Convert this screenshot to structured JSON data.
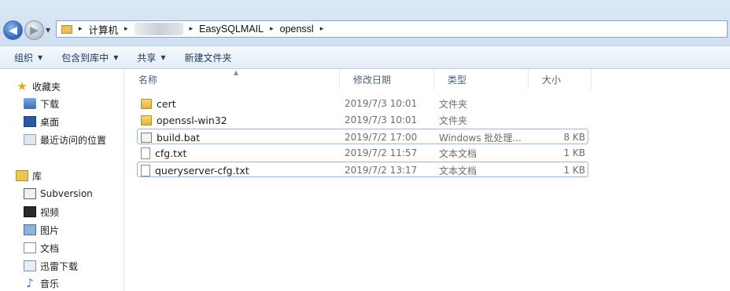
{
  "address_bar": {
    "back_label": "◀",
    "forward_label": "▶",
    "history_dropdown": "▼",
    "crumbs": [
      "计算机",
      "EasySQLMAIL",
      "openssl"
    ],
    "separator": "▸"
  },
  "toolbar": {
    "items": [
      "组织",
      "包含到库中",
      "共享",
      "新建文件夹"
    ],
    "dropdown_arrow": "▼"
  },
  "sidebar": {
    "favorites_title": "收藏夹",
    "favorites": [
      "下载",
      "桌面",
      "最近访问的位置"
    ],
    "library_title": "库",
    "libraries": [
      "Subversion",
      "视频",
      "图片",
      "文档",
      "迅雷下载",
      "音乐"
    ]
  },
  "file_list": {
    "columns": [
      "名称",
      "修改日期",
      "类型",
      "大小"
    ],
    "sort_indicator": "▲",
    "rows": [
      {
        "name": "cert",
        "date": "2019/7/3 10:01",
        "type": "文件夹",
        "size": "",
        "icon": "folder-icon"
      },
      {
        "name": "openssl-win32",
        "date": "2019/7/3 10:01",
        "type": "文件夹",
        "size": "",
        "icon": "folder-icon"
      },
      {
        "name": "build.bat",
        "date": "2019/7/2 17:00",
        "type": "Windows 批处理...",
        "size": "8 KB",
        "icon": "batch-file-icon"
      },
      {
        "name": "cfg.txt",
        "date": "2019/7/2 11:57",
        "type": "文本文档",
        "size": "1 KB",
        "icon": "text-file-icon"
      },
      {
        "name": "queryserver-cfg.txt",
        "date": "2019/7/2 13:17",
        "type": "文本文档",
        "size": "1 KB",
        "icon": "text-file-icon"
      }
    ]
  }
}
